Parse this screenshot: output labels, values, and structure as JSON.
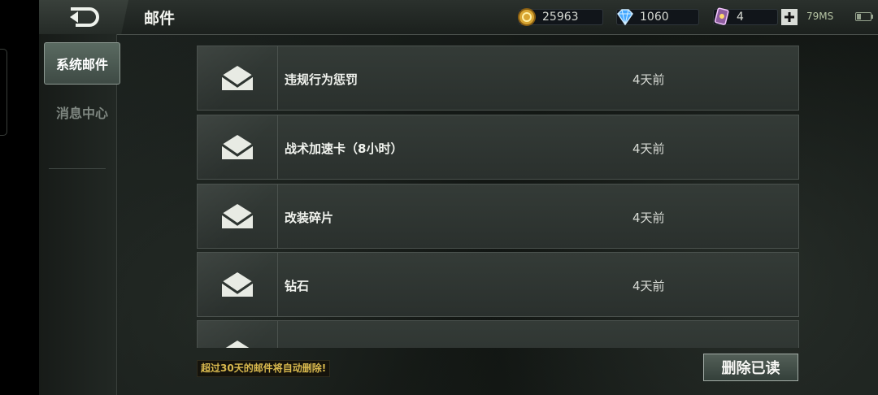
{
  "header": {
    "title": "邮件",
    "back_icon": "back-arrow-icon",
    "currencies": [
      {
        "name": "coin",
        "icon": "gold-coin-icon",
        "value": "25963"
      },
      {
        "name": "diamond",
        "icon": "diamond-icon",
        "value": "1060"
      },
      {
        "name": "card",
        "icon": "card-icon",
        "value": "4"
      }
    ],
    "ping": "79MS",
    "colors": {
      "gold": "#d8a532",
      "diamond": "#45a8ff",
      "card": "#8f5ea0"
    }
  },
  "sidebar": {
    "tabs": [
      {
        "label": "系统邮件",
        "active": true
      },
      {
        "label": "消息中心",
        "active": false
      }
    ]
  },
  "mails": [
    {
      "subject": "违规行为惩罚",
      "time": "4天前"
    },
    {
      "subject": "战术加速卡（8小时）",
      "time": "4天前"
    },
    {
      "subject": "改装碎片",
      "time": "4天前"
    },
    {
      "subject": "钻石",
      "time": "4天前"
    }
  ],
  "footer": {
    "notice": "超过30天的邮件将自动删除!",
    "delete_label": "删除已读"
  }
}
